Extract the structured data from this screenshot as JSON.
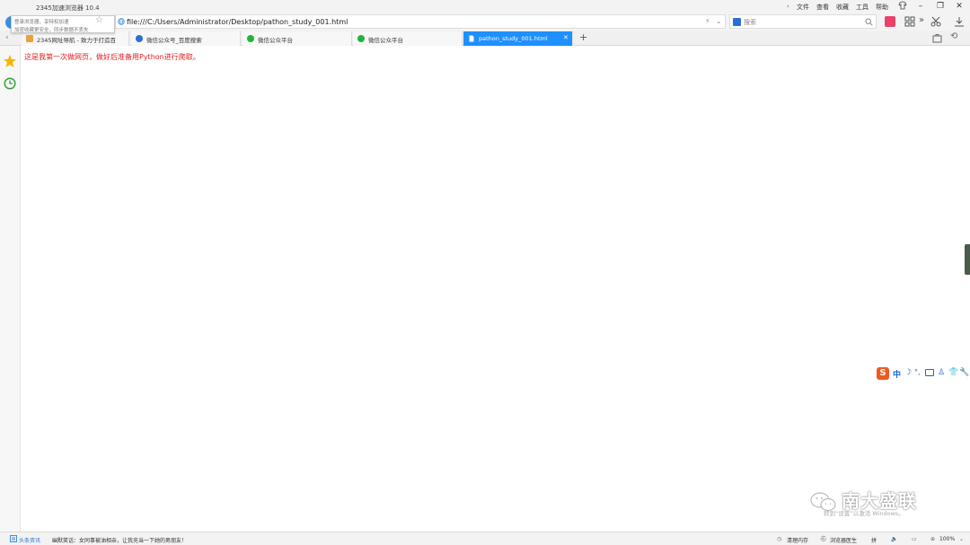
{
  "window": {
    "title": "2345加速浏览器 10.4",
    "menu": [
      "文件",
      "查看",
      "收藏",
      "工具",
      "帮助"
    ]
  },
  "tooltip": {
    "line1": "登录浏览器，享特权加速",
    "line2": "加密收藏更安全，同步数据不丢失"
  },
  "address_bar": {
    "url": "file:///C:/Users/Administrator/Desktop/pathon_study_001.html",
    "search_placeholder": "搜索"
  },
  "tabs": [
    {
      "label": "2345网址导航 - 致力于打造百",
      "active": false,
      "icon": "2345-nav-icon"
    },
    {
      "label": "微信公众号_百度搜索",
      "active": false,
      "icon": "baidu-paw-icon"
    },
    {
      "label": "微信公众平台",
      "active": false,
      "icon": "wechat-icon"
    },
    {
      "label": "微信公众平台",
      "active": false,
      "icon": "wechat-icon"
    },
    {
      "label": "pathon_study_001.html",
      "active": true,
      "icon": "document-icon"
    }
  ],
  "page": {
    "content": "这是我第一次做网页，做好后准备用Python进行爬取。"
  },
  "status_bar": {
    "news_label": "头条资讯",
    "ticker": "幽默笑话：女同事被油相亲，让我充当一下她的男朋友！",
    "clean_memory": "清理内存",
    "browser_doctor": "浏览器医生",
    "ime_state": "拼",
    "zoom": "100%"
  },
  "ime_toolbar": {
    "logo": "S",
    "mode": "中"
  },
  "watermark": {
    "brand": "南大盛联",
    "activate_line": "转到“设置”以激活 Windows。"
  },
  "colors": {
    "active_tab": "#1e90ff",
    "content_text": "#e02020",
    "sogou_orange": "#f05a22"
  }
}
